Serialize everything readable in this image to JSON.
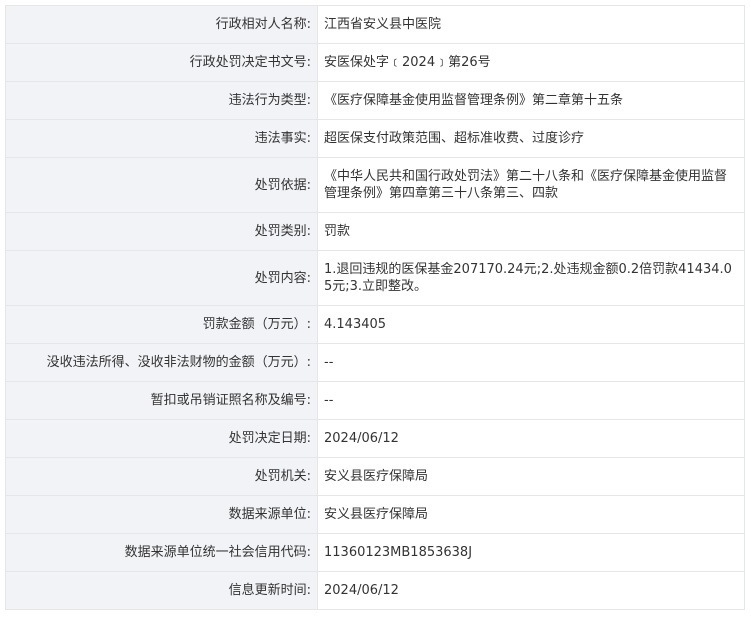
{
  "rows": [
    {
      "label": "行政相对人名称:",
      "value": "江西省安义县中医院"
    },
    {
      "label": "行政处罚决定书文号:",
      "value": "安医保处字﹝2024﹞第26号"
    },
    {
      "label": "违法行为类型:",
      "value": "《医疗保障基金使用监督管理条例》第二章第十五条"
    },
    {
      "label": "违法事实:",
      "value": "超医保支付政策范围、超标准收费、过度诊疗"
    },
    {
      "label": "处罚依据:",
      "value": "《中华人民共和国行政处罚法》第二十八条和《医疗保障基金使用监督管理条例》第四章第三十八条第三、四款"
    },
    {
      "label": "处罚类别:",
      "value": "罚款"
    },
    {
      "label": "处罚内容:",
      "value": "1.退回违规的医保基金207170.24元;2.处违规金额0.2倍罚款41434.05元;3.立即整改。"
    },
    {
      "label": "罚款金额（万元）:",
      "value": "4.143405"
    },
    {
      "label": "没收违法所得、没收非法财物的金额（万元）:",
      "value": "--"
    },
    {
      "label": "暂扣或吊销证照名称及编号:",
      "value": "--"
    },
    {
      "label": "处罚决定日期:",
      "value": "2024/06/12"
    },
    {
      "label": "处罚机关:",
      "value": "安义县医疗保障局"
    },
    {
      "label": "数据来源单位:",
      "value": "安义县医疗保障局"
    },
    {
      "label": "数据来源单位统一社会信用代码:",
      "value": "11360123MB1853638J"
    },
    {
      "label": "信息更新时间:",
      "value": "2024/06/12"
    }
  ]
}
